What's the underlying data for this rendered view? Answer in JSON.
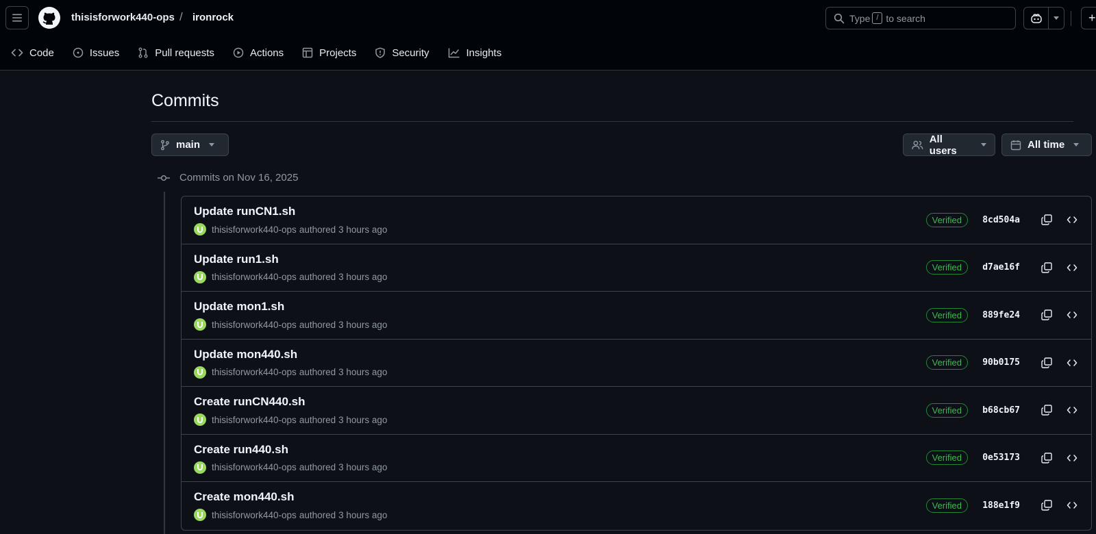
{
  "header": {
    "owner": "thisisforwork440-ops",
    "separator": "/",
    "repo": "ironrock",
    "search_prefix": "Type",
    "search_key": "/",
    "search_suffix": "to search",
    "plus_label": "+"
  },
  "nav": [
    {
      "label": "Code",
      "icon": "code-icon"
    },
    {
      "label": "Issues",
      "icon": "issue-icon"
    },
    {
      "label": "Pull requests",
      "icon": "pull-request-icon"
    },
    {
      "label": "Actions",
      "icon": "play-icon"
    },
    {
      "label": "Projects",
      "icon": "table-icon"
    },
    {
      "label": "Security",
      "icon": "shield-icon"
    },
    {
      "label": "Insights",
      "icon": "graph-icon"
    }
  ],
  "page": {
    "title": "Commits",
    "branch": "main",
    "users_filter": "All users",
    "time_filter": "All time",
    "group_heading": "Commits on Nov 16, 2025"
  },
  "commits": [
    {
      "message": "Update runCN1.sh",
      "author": "thisisforwork440-ops",
      "action": "authored",
      "time": "3 hours ago",
      "badge": "Verified",
      "sha": "8cd504a"
    },
    {
      "message": "Update run1.sh",
      "author": "thisisforwork440-ops",
      "action": "authored",
      "time": "3 hours ago",
      "badge": "Verified",
      "sha": "d7ae16f"
    },
    {
      "message": "Update mon1.sh",
      "author": "thisisforwork440-ops",
      "action": "authored",
      "time": "3 hours ago",
      "badge": "Verified",
      "sha": "889fe24"
    },
    {
      "message": "Update mon440.sh",
      "author": "thisisforwork440-ops",
      "action": "authored",
      "time": "3 hours ago",
      "badge": "Verified",
      "sha": "90b0175"
    },
    {
      "message": "Create runCN440.sh",
      "author": "thisisforwork440-ops",
      "action": "authored",
      "time": "3 hours ago",
      "badge": "Verified",
      "sha": "b68cb67"
    },
    {
      "message": "Create run440.sh",
      "author": "thisisforwork440-ops",
      "action": "authored",
      "time": "3 hours ago",
      "badge": "Verified",
      "sha": "0e53173"
    },
    {
      "message": "Create mon440.sh",
      "author": "thisisforwork440-ops",
      "action": "authored",
      "time": "3 hours ago",
      "badge": "Verified",
      "sha": "188e1f9"
    }
  ],
  "colors": {
    "background": "#0d1117",
    "header_background": "#010409",
    "border": "#3d444d",
    "verified": "#3fb950",
    "avatar": "#9bd85e"
  }
}
